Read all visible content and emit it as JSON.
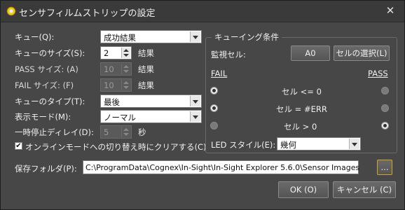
{
  "window": {
    "title": "センサフィルムストリップの設定",
    "close_glyph": "✕"
  },
  "left": {
    "queue_label": "キュー(Q):",
    "queue_value": "成功結果",
    "queue_size_label": "キューのサイズ(S):",
    "queue_size_value": "2",
    "queue_size_unit": "結果",
    "pass_size_label": "PASS サイズ: (A)",
    "pass_size_value": "10",
    "pass_size_unit": "結果",
    "fail_size_label": "FAIL サイズ: (F)",
    "fail_size_value": "10",
    "fail_size_unit": "結果",
    "queue_type_label": "キューのタイプ(T):",
    "queue_type_value": "最後",
    "display_mode_label": "表示モード(M):",
    "display_mode_value": "ノーマル",
    "pause_delay_label": "一時停止ディレイ(D):",
    "pause_delay_value": "5",
    "pause_delay_unit": "秒",
    "clear_checkbox_label": "オンラインモードへの切り替え時にクリアする(C)",
    "clear_checkbox_checked": true,
    "check_glyph": "✔"
  },
  "queue_conditions": {
    "legend": "キューイング条件",
    "monitor_cell_label": "監視セル:",
    "monitor_cell_value": "A0",
    "select_cell_button": "セルの選択(L)",
    "fail_header": "FAIL",
    "pass_header": "PASS",
    "rows": [
      {
        "label": "セル <= 0",
        "fail": true,
        "pass": false
      },
      {
        "label": "セル = #ERR",
        "fail": true,
        "pass": false
      },
      {
        "label": "セル > 0",
        "fail": false,
        "pass": true
      }
    ],
    "led_style_label": "LED スタイル(E):",
    "led_style_value": "幾何"
  },
  "save_folder": {
    "label": "保存フォルダ(P):",
    "path": "C:\\ProgramData\\Cognex\\In-Sight\\In-Sight Explorer 5.6.0\\Sensor Images",
    "browse_button": "..."
  },
  "footer": {
    "ok_button": "OK (O)",
    "cancel_button": "キャンセル (C)"
  },
  "colors": {
    "window_bg": "#474747",
    "titlebar_bg": "#3a3a3a",
    "text": "#f0f0f0"
  }
}
